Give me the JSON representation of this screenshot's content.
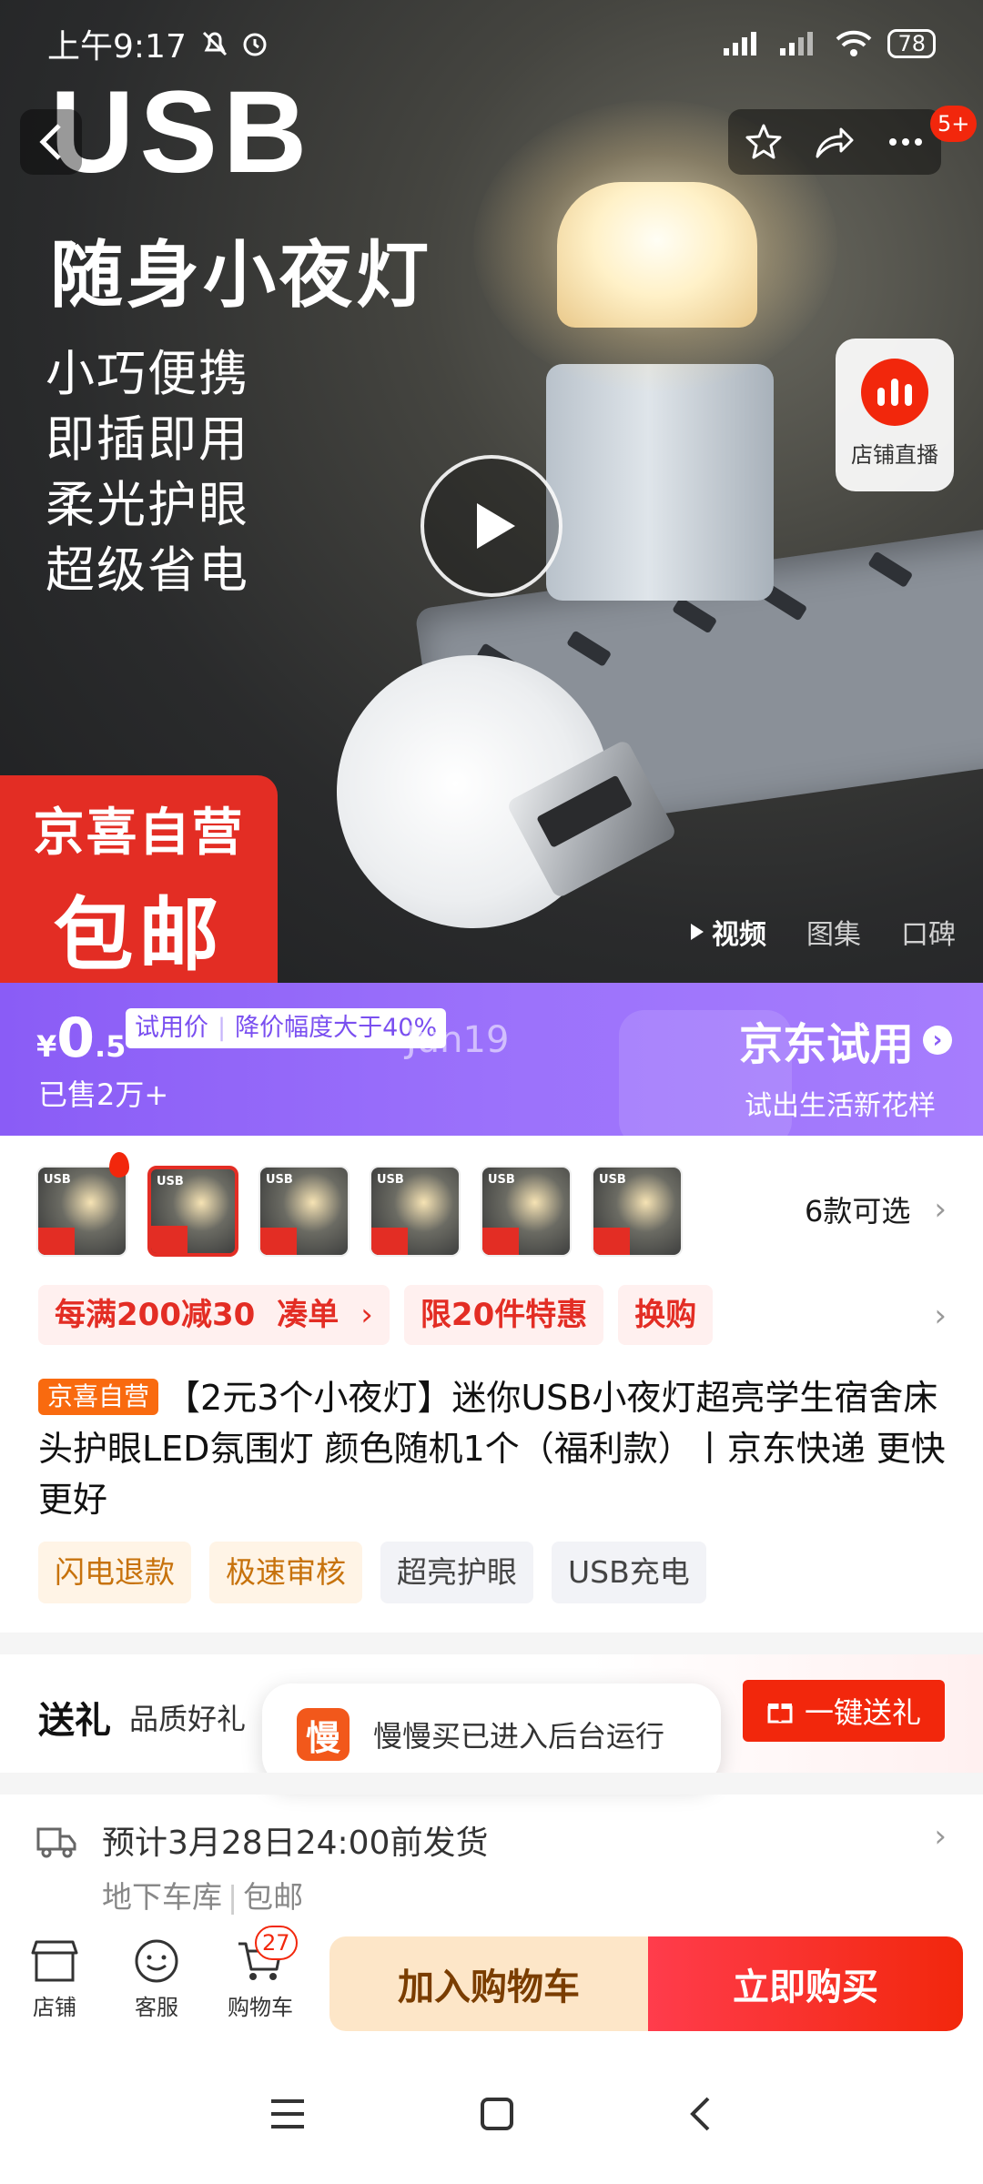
{
  "status_bar": {
    "time": "上午9:17",
    "battery": "78"
  },
  "header": {
    "notification_count": "5+"
  },
  "hero": {
    "title": "USB",
    "subtitle": "随身小夜灯",
    "features": [
      "小巧便携",
      "即插即用",
      "柔光护眼",
      "超级省电"
    ],
    "badge_line1": "京喜自营",
    "badge_line2": "包邮",
    "live_label": "店铺直播",
    "media_tabs": [
      "视频",
      "图集",
      "口碑"
    ]
  },
  "promo": {
    "currency": "¥",
    "price_int": "0",
    "price_dec": ".5",
    "tag_left": "试用价",
    "tag_right": "降价幅度大于40%",
    "ghost_text": "Jun19",
    "sold": "已售2万+",
    "brand": "京东试用",
    "slogan": "试出生活新花样"
  },
  "variants": {
    "thumbs": [
      {
        "label": "USB\n随身小夜灯"
      },
      {
        "label": "USB\n随身小夜灯"
      },
      {
        "label": "USB\n随身小夜灯"
      },
      {
        "label": "USB\n随身小夜灯"
      },
      {
        "label": "USB\n随身小夜灯"
      },
      {
        "label": "USB\n随身小夜灯"
      }
    ],
    "count_text": "6款可选"
  },
  "promo_tags": [
    "每满200减30",
    "凑单",
    "限20件特惠",
    "换购"
  ],
  "product": {
    "badge": "京喜自营",
    "title": "【2元3个小夜灯】迷你USB小夜灯超亮学生宿舍床头护眼LED氛围灯 颜色随机1个（福利款）丨京东快递 更快更好",
    "feature_tags": [
      {
        "text": "闪电退款",
        "style": "orange"
      },
      {
        "text": "极速审核",
        "style": "orange"
      },
      {
        "text": "超亮护眼",
        "style": "grey"
      },
      {
        "text": "USB充电",
        "style": "grey"
      }
    ]
  },
  "gift": {
    "label": "送礼",
    "desc": "品质好礼",
    "button": "一键送礼"
  },
  "toast": {
    "logo": "慢",
    "message": "慢慢买已进入后台运行"
  },
  "shipping": {
    "text": "预计3月28日24:00前发货",
    "location": "地下车库",
    "free": "包邮"
  },
  "bottom_bar": {
    "store": "店铺",
    "service": "客服",
    "cart": "购物车",
    "cart_count": "27",
    "add_cart": "加入购物车",
    "buy_now": "立即购买"
  },
  "colors": {
    "jd_red": "#f2270c",
    "trial_purple": "#8a5cf6",
    "cart_bg": "#fde6c8"
  }
}
